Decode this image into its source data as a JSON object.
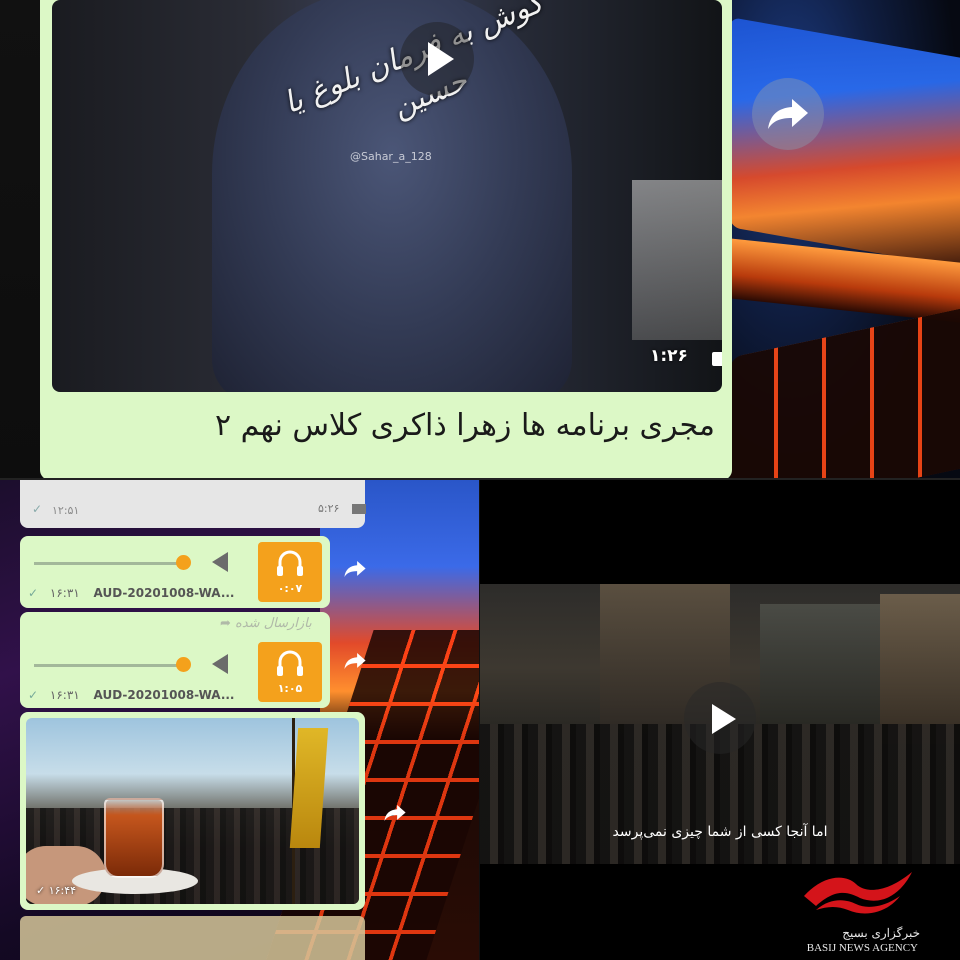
{
  "top_post": {
    "calligraphy": "گوش به فرمان بلوغ یا حسین",
    "watermark_handle": "@Sahar_a_128",
    "duration": "۱:۲۶",
    "caption": "مجری برنامه ها زهرا ذاکری کلاس نهم ۲"
  },
  "chat": {
    "prev_video": {
      "time": "۱۲:۵۱",
      "duration": "۵:۲۶"
    },
    "audio_1": {
      "length": "۰:۰۷",
      "time": "۱۶:۳۱",
      "filename": "AUD-20201008-WA..."
    },
    "forwarded_label": "بازارسال شده",
    "audio_2": {
      "length": "۱:۰۵",
      "time": "۱۶:۳۱",
      "filename": "AUD-20201008-WA..."
    },
    "photo": {
      "time": "۱۶:۴۴"
    }
  },
  "side_video": {
    "subtitle": "اما آنجا کسی از شما چیزی نمی‌پرسد"
  },
  "branding": {
    "name_fa": "خبرگزاری بسیج",
    "name_en": "BASIJ NEWS AGENCY",
    "accent": "#d4141a"
  },
  "colors": {
    "bubble": "#dcf8c6",
    "audio_accent": "#f4a11c"
  }
}
